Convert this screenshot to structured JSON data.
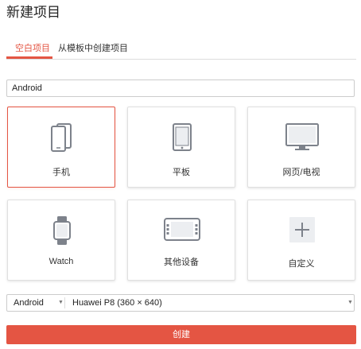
{
  "page": {
    "title": "新建项目"
  },
  "tabs": [
    {
      "label": "空白项目",
      "active": true
    },
    {
      "label": "从模板中创建项目",
      "active": false
    }
  ],
  "project_name": {
    "value": "Android"
  },
  "device_cards": [
    {
      "label": "手机",
      "icon": "phone-icon",
      "selected": true
    },
    {
      "label": "平板",
      "icon": "tablet-icon",
      "selected": false
    },
    {
      "label": "网页/电视",
      "icon": "monitor-icon",
      "selected": false
    },
    {
      "label": "Watch",
      "icon": "watch-icon",
      "selected": false
    },
    {
      "label": "其他设备",
      "icon": "other-device-icon",
      "selected": false
    },
    {
      "label": "自定义",
      "icon": "plus-icon",
      "selected": false
    }
  ],
  "platform_select": {
    "value": "Android"
  },
  "device_select": {
    "value": "Huawei P8 (360 × 640)"
  },
  "create_button": {
    "label": "创建"
  },
  "colors": {
    "accent": "#e45543",
    "icon": "#7d828b"
  }
}
